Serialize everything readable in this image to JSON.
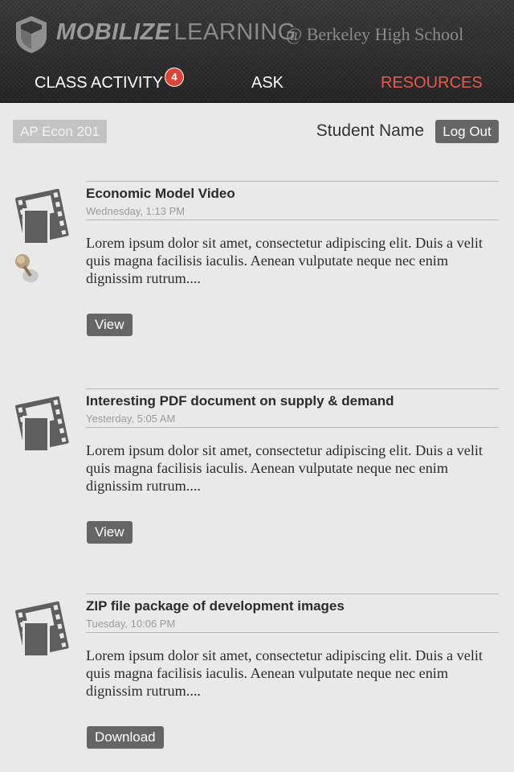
{
  "header": {
    "brand_bold": "MOBILIZE",
    "brand_light": "LEARNING",
    "school": "@ Berkeley High School",
    "tabs": [
      {
        "label": "CLASS ACTIVITY",
        "badge": "4",
        "active": false
      },
      {
        "label": "ASK",
        "active": false
      },
      {
        "label": "RESOURCES",
        "active": true
      }
    ]
  },
  "subheader": {
    "course": "AP Econ 201",
    "student": "Student Name",
    "logout_label": "Log Out"
  },
  "posts": [
    {
      "title": "Economic Model Video",
      "time": "Wednesday, 1:13 PM",
      "body": "Lorem ipsum dolor sit amet, consectetur adipiscing elit. Duis a velit quis magna facilisis iaculis. Aenean vulputate neque nec enim dignissim rutrum....",
      "action": "View",
      "icon": "film-icon",
      "pinned": true
    },
    {
      "title": "Interesting PDF document on supply & demand",
      "time": "Yesterday, 5:05 AM",
      "body": "Lorem ipsum dolor sit amet, consectetur adipiscing elit. Duis a velit quis magna facilisis iaculis. Aenean vulputate neque nec enim dignissim rutrum....",
      "action": "View",
      "icon": "film-icon",
      "pinned": false
    },
    {
      "title": "ZIP file package of development images",
      "time": "Tuesday, 10:06 PM",
      "body": "Lorem ipsum dolor sit amet, consectetur adipiscing elit. Duis a velit quis magna facilisis iaculis. Aenean vulputate neque nec enim dignissim rutrum....",
      "action": "Download",
      "icon": "film-icon",
      "pinned": false
    }
  ],
  "colors": {
    "accent_active_tab": "#e85a4f",
    "badge": "#d9453b",
    "button": "#656565"
  }
}
